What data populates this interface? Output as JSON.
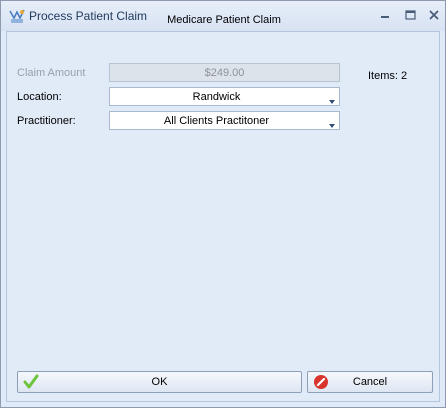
{
  "window": {
    "title": "Process Patient Claim",
    "icon": "app-logo-icon",
    "controls": [
      "minimize-icon",
      "maximize-icon",
      "close-icon"
    ]
  },
  "form": {
    "heading": "Medicare Patient Claim",
    "claim_amount": {
      "label": "Claim Amount",
      "value": "$249.00",
      "enabled": false
    },
    "location": {
      "label": "Location:",
      "value": "Randwick"
    },
    "practitioner": {
      "label": "Practitioner:",
      "value": "All Clients Practitoner"
    },
    "items_label": "Items: 2"
  },
  "buttons": {
    "ok_label": "OK",
    "cancel_label": "Cancel",
    "ok_icon": "check-icon",
    "cancel_icon": "cancel-icon"
  },
  "colors": {
    "title_text": "#1e395b",
    "dialog_background": "#e1ebf8",
    "ok_icon": "#6cc43b",
    "cancel_icon": "#d9342b"
  }
}
